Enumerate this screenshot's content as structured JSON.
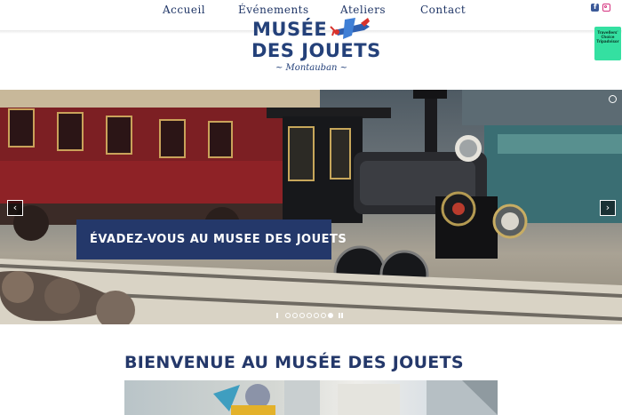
{
  "nav": {
    "items": [
      {
        "label": "Accueil"
      },
      {
        "label": "Événements"
      },
      {
        "label": "Ateliers"
      },
      {
        "label": "Contact"
      }
    ]
  },
  "social": {
    "facebook_icon": "facebook-icon",
    "instagram_icon": "instagram-icon"
  },
  "logo": {
    "line1": "MUSÉE",
    "line2": "DES JOUETS",
    "subtitle": "~ Montauban ~",
    "plane_icon": "toy-plane-icon",
    "color": "#24417a"
  },
  "tripadvisor": {
    "text": "Travellers' Choice Tripadvisor",
    "color": "#34e0a1"
  },
  "hero": {
    "caption": "ÉVADEZ-VOUS AU MUSEE DES JOUETS",
    "caption_bg": "#24386a",
    "prev_icon": "‹",
    "next_icon": "›",
    "slide_count": 8,
    "active_slide": 8
  },
  "welcome": {
    "title": "BIENVENUE AU MUSÉE DES JOUETS",
    "color": "#24386a"
  }
}
